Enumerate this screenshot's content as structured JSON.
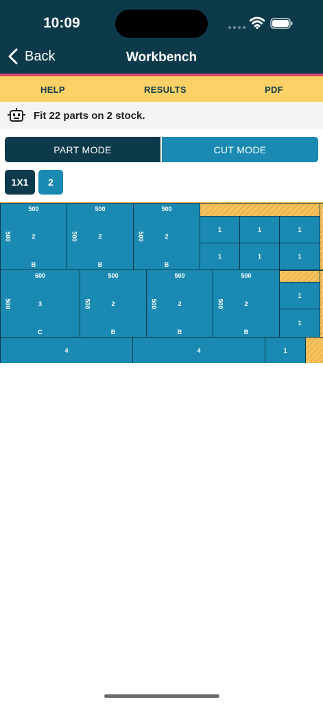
{
  "status": {
    "time": "10:09"
  },
  "nav": {
    "back_label": "Back",
    "title": "Workbench"
  },
  "tabs": {
    "help": "HELP",
    "results": "RESULTS",
    "pdf": "PDF"
  },
  "info": {
    "message": "Fit 22 parts on 2 stock."
  },
  "modes": {
    "part": "PART MODE",
    "cut": "CUT MODE"
  },
  "stock_chips": {
    "layout": "1X1",
    "count": "2"
  },
  "parts": {
    "p1": {
      "width": "500",
      "height": "500",
      "qty": "2",
      "group": "B"
    },
    "p2": {
      "width": "500",
      "height": "500",
      "qty": "2",
      "group": "B"
    },
    "p3": {
      "width": "500",
      "height": "500",
      "qty": "2",
      "group": "B"
    },
    "p4": {
      "width": "600",
      "height": "500",
      "qty": "3",
      "group": "C"
    },
    "p5": {
      "width": "500",
      "height": "500",
      "qty": "2",
      "group": "B"
    },
    "p6": {
      "width": "500",
      "height": "500",
      "qty": "2",
      "group": "B"
    },
    "p7": {
      "width": "500",
      "height": "500",
      "qty": "2",
      "group": "B"
    },
    "small": "1",
    "strip": "4"
  },
  "colors": {
    "header": "#0c3a4a",
    "accent_pink": "#d9466f",
    "tabbar": "#fdd166",
    "part": "#1a8ab2",
    "waste": "#f6c25e"
  }
}
